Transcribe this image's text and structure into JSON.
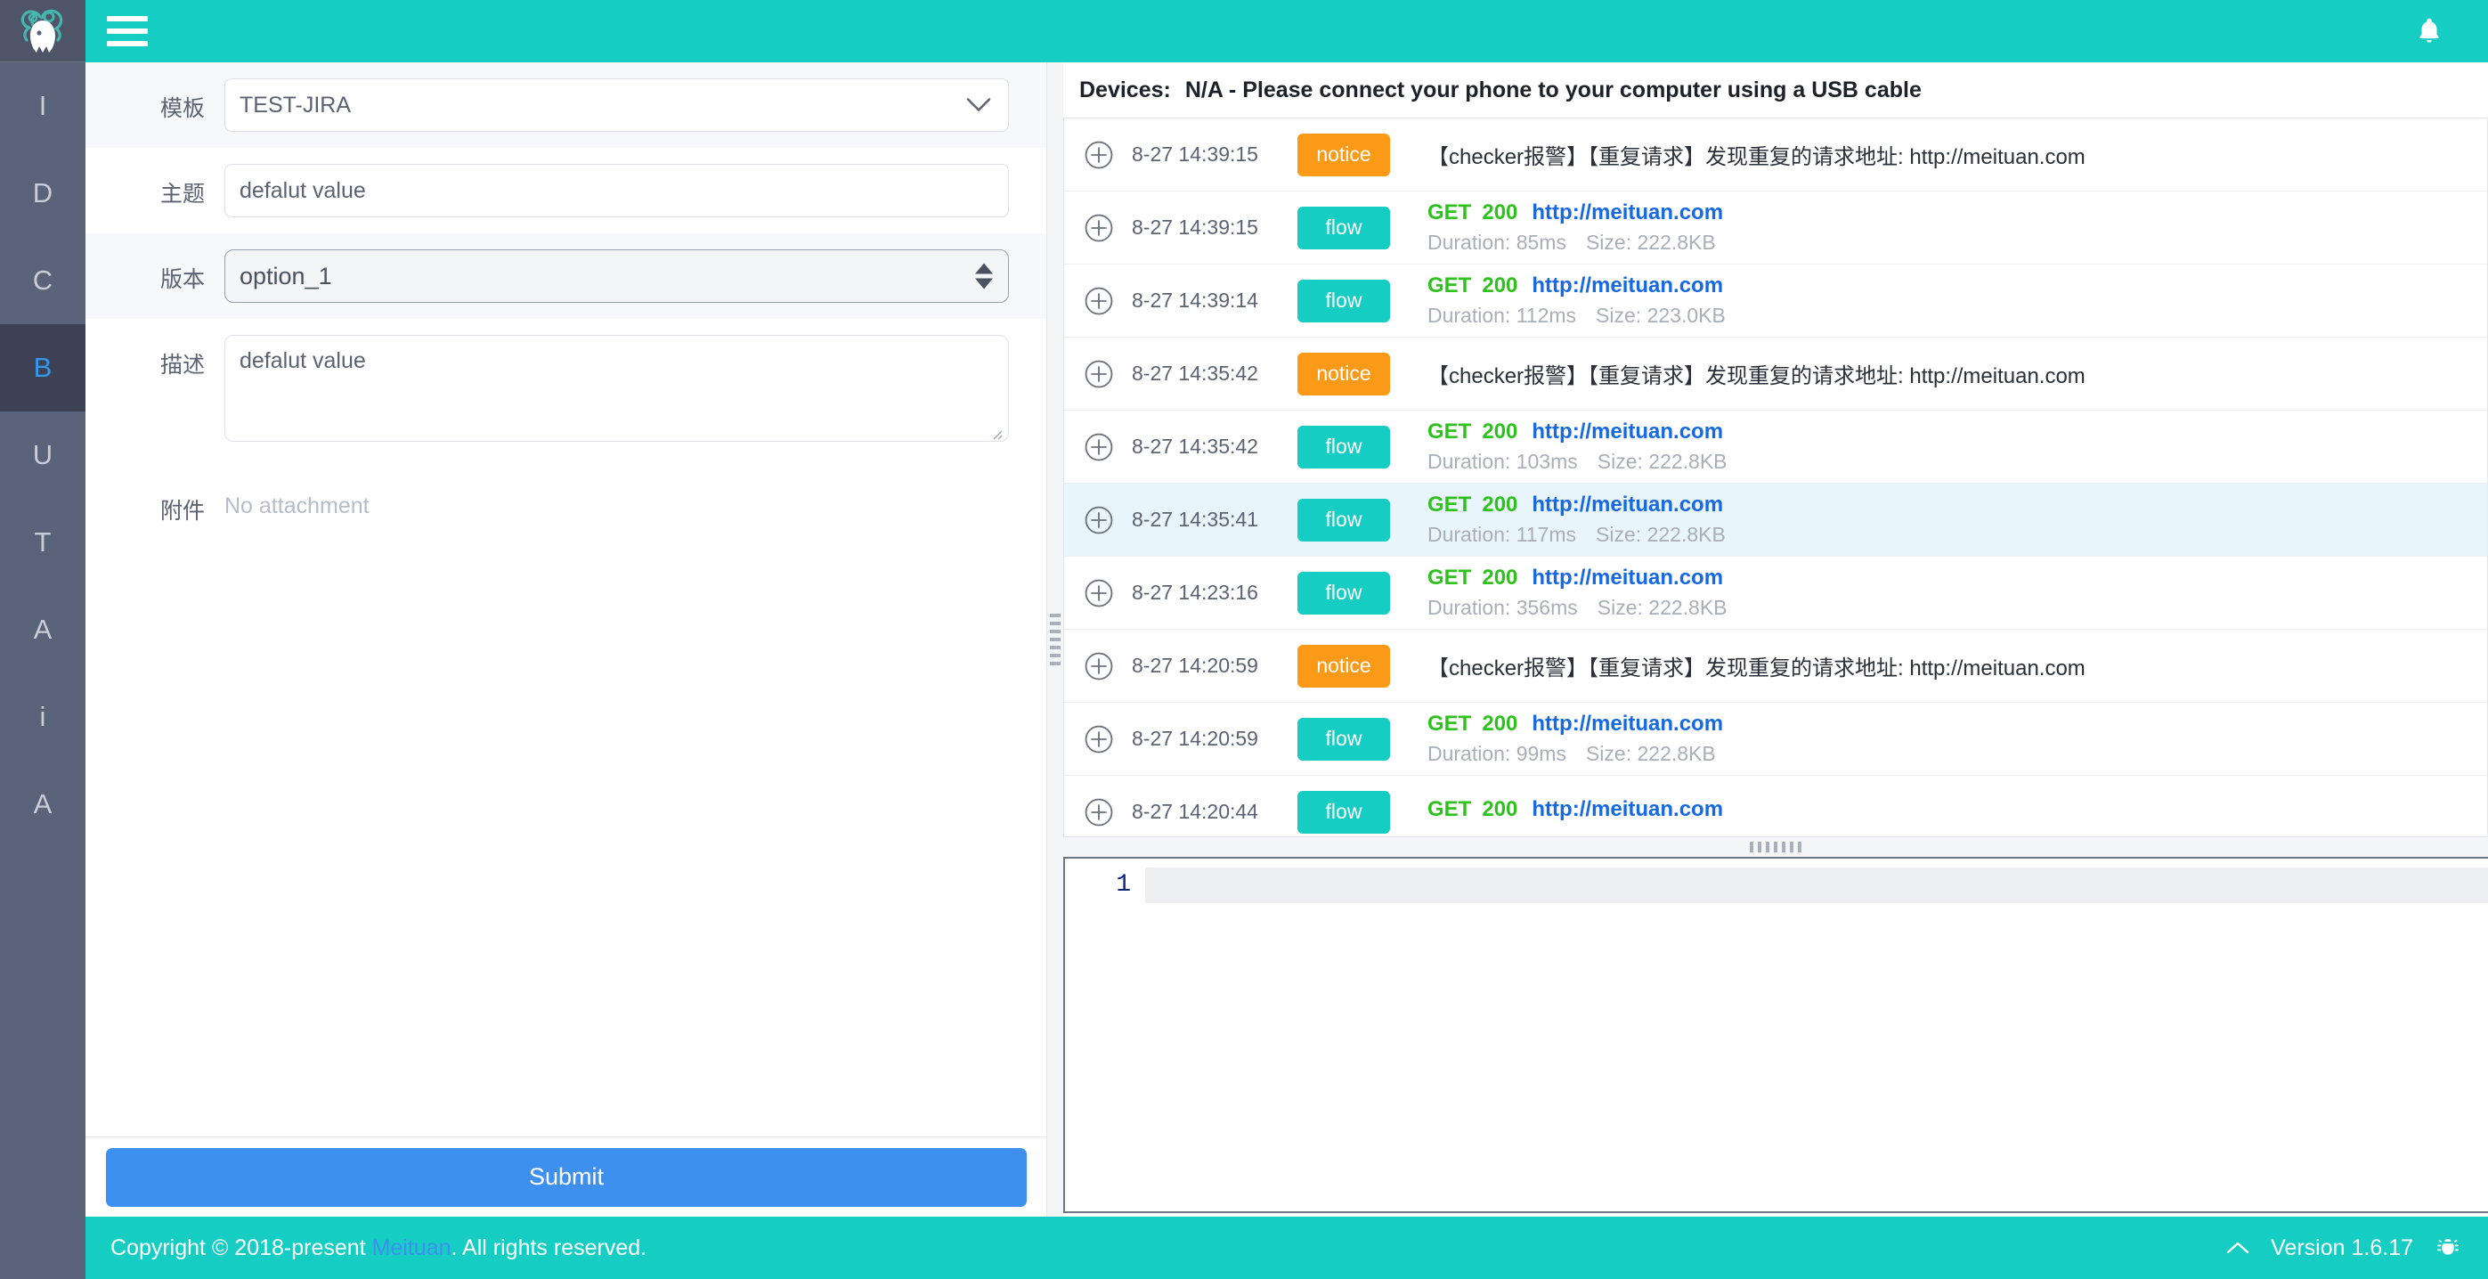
{
  "app": {
    "logo_name": "squid-mascot-logo",
    "accent_teal": "#15cdc3",
    "sidebar_bg": "#5a6379",
    "sidebar_active_bg": "#3d4354",
    "sidebar_active_color": "#3699f0",
    "primary_blue": "#3d90ef"
  },
  "header": {
    "menu_icon": "hamburger-icon",
    "bell_icon": "bell-icon"
  },
  "sidebar": {
    "items": [
      {
        "label": "I",
        "name": "sidebar-item-i",
        "active": false
      },
      {
        "label": "D",
        "name": "sidebar-item-d",
        "active": false
      },
      {
        "label": "C",
        "name": "sidebar-item-c",
        "active": false
      },
      {
        "label": "B",
        "name": "sidebar-item-b",
        "active": true
      },
      {
        "label": "U",
        "name": "sidebar-item-u",
        "active": false
      },
      {
        "label": "T",
        "name": "sidebar-item-t",
        "active": false
      },
      {
        "label": "A",
        "name": "sidebar-item-a1",
        "active": false
      },
      {
        "label": "i",
        "name": "sidebar-item-i2",
        "active": false
      },
      {
        "label": "A",
        "name": "sidebar-item-a2",
        "active": false
      }
    ]
  },
  "form": {
    "template": {
      "label": "模板",
      "value": "TEST-JIRA",
      "icon": "chevron-down-icon"
    },
    "subject": {
      "label": "主题",
      "value": "defalut value",
      "placeholder": "defalut value"
    },
    "version": {
      "label": "版本",
      "value": "option_1",
      "options": [
        "option_1"
      ],
      "icon": "select-spinner-icon"
    },
    "description": {
      "label": "描述",
      "value": "defalut value",
      "placeholder": "defalut value",
      "resize_grip": "resize-grip-icon"
    },
    "attachment": {
      "label": "附件",
      "value": "No attachment"
    },
    "submit_label": "Submit"
  },
  "devices": {
    "label": "Devices:",
    "value": "N/A - Please connect your phone to your computer using a USB cable"
  },
  "requests": [
    {
      "type": "notice",
      "time": "8-27 14:39:15",
      "tag": "notice",
      "text": "【checker报警】【重复请求】发现重复的请求地址: http://meituan.com",
      "selected": false
    },
    {
      "type": "flow",
      "time": "8-27 14:39:15",
      "tag": "flow",
      "method": "GET",
      "status": "200",
      "url": "http://meituan.com",
      "duration": "Duration: 85ms",
      "size": "Size: 222.8KB",
      "selected": false
    },
    {
      "type": "flow",
      "time": "8-27 14:39:14",
      "tag": "flow",
      "method": "GET",
      "status": "200",
      "url": "http://meituan.com",
      "duration": "Duration: 112ms",
      "size": "Size: 223.0KB",
      "selected": false
    },
    {
      "type": "notice",
      "time": "8-27 14:35:42",
      "tag": "notice",
      "text": "【checker报警】【重复请求】发现重复的请求地址: http://meituan.com",
      "selected": false
    },
    {
      "type": "flow",
      "time": "8-27 14:35:42",
      "tag": "flow",
      "method": "GET",
      "status": "200",
      "url": "http://meituan.com",
      "duration": "Duration: 103ms",
      "size": "Size: 222.8KB",
      "selected": false
    },
    {
      "type": "flow",
      "time": "8-27 14:35:41",
      "tag": "flow",
      "method": "GET",
      "status": "200",
      "url": "http://meituan.com",
      "duration": "Duration: 117ms",
      "size": "Size: 222.8KB",
      "selected": true
    },
    {
      "type": "flow",
      "time": "8-27 14:23:16",
      "tag": "flow",
      "method": "GET",
      "status": "200",
      "url": "http://meituan.com",
      "duration": "Duration: 356ms",
      "size": "Size: 222.8KB",
      "selected": false
    },
    {
      "type": "notice",
      "time": "8-27 14:20:59",
      "tag": "notice",
      "text": "【checker报警】【重复请求】发现重复的请求地址: http://meituan.com",
      "selected": false
    },
    {
      "type": "flow",
      "time": "8-27 14:20:59",
      "tag": "flow",
      "method": "GET",
      "status": "200",
      "url": "http://meituan.com",
      "duration": "Duration: 99ms",
      "size": "Size: 222.8KB",
      "selected": false
    },
    {
      "type": "flow",
      "time": "8-27 14:20:44",
      "tag": "flow",
      "method": "GET",
      "status": "200",
      "url": "http://meituan.com",
      "duration": "",
      "size": "",
      "selected": false
    }
  ],
  "editor": {
    "line_numbers": [
      "1"
    ],
    "content": ""
  },
  "footer": {
    "copyright_prefix": "Copyright © 2018-present ",
    "brand_link": "Meituan",
    "copyright_suffix": ". All rights reserved.",
    "chevron_icon": "chevron-up-icon",
    "version": "Version 1.6.17",
    "bug_icon": "bug-icon"
  }
}
